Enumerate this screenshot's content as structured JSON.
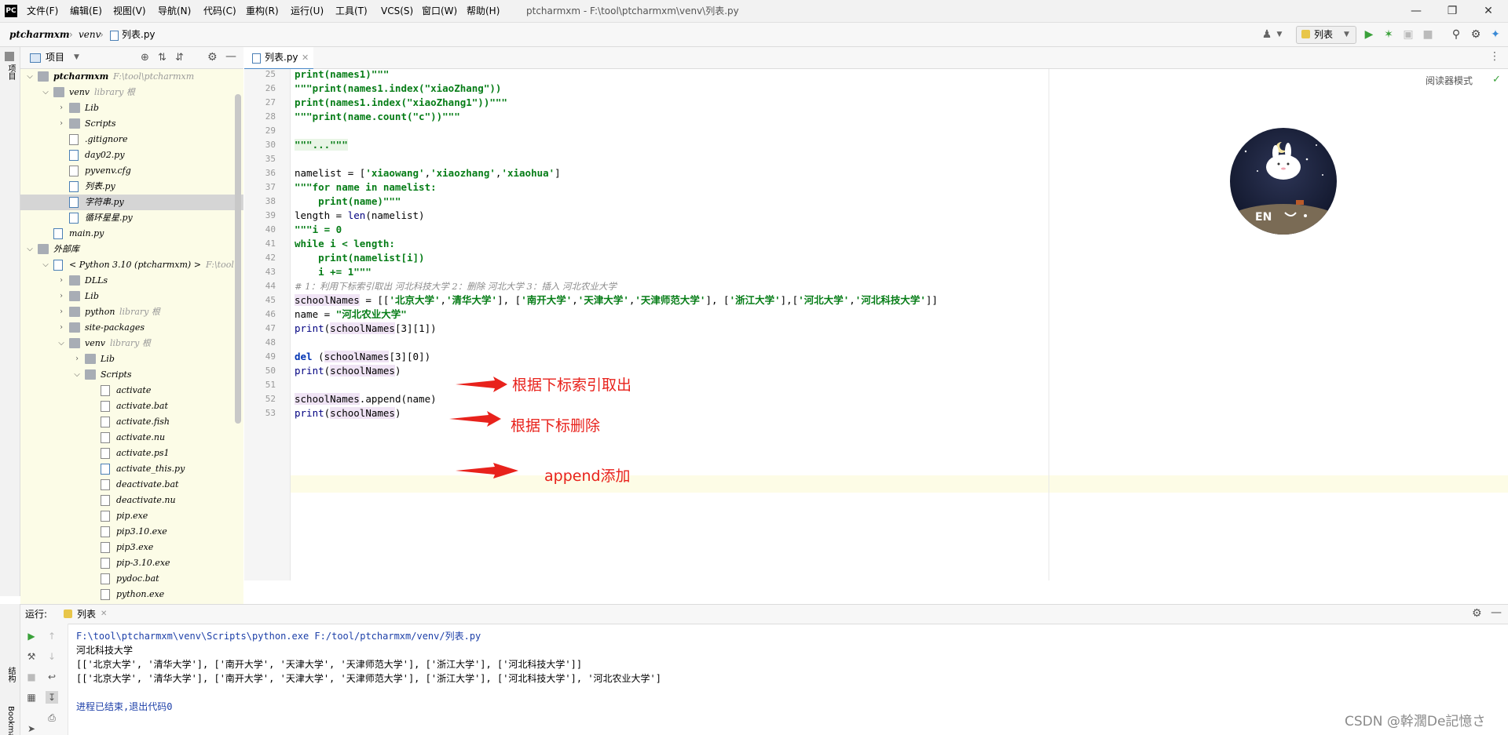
{
  "titlebar": {
    "menu": [
      "文件(F)",
      "编辑(E)",
      "视图(V)",
      "导航(N)",
      "代码(C)",
      "重构(R)",
      "运行(U)",
      "工具(T)",
      "VCS(S)",
      "窗口(W)",
      "帮助(H)"
    ],
    "title": "ptcharmxm - F:\\tool\\ptcharmxm\\venv\\列表.py",
    "logo": "PC"
  },
  "breadcrumb": [
    "ptcharmxm",
    "venv",
    "列表.py"
  ],
  "toolbar": {
    "run_config": "列表"
  },
  "left_strip": {
    "project_label": "项目",
    "structure_label": "结构",
    "bookmarks_label": "Bookmarks"
  },
  "project_panel": {
    "header": "项目",
    "tree": [
      {
        "label": "ptcharmxm",
        "hint": "F:\\tool\\ptcharmxm",
        "level": 0,
        "type": "folder",
        "expanded": true
      },
      {
        "label": "venv",
        "hint": "library 根",
        "level": 1,
        "type": "folder",
        "expanded": true
      },
      {
        "label": "Lib",
        "level": 2,
        "type": "folder",
        "expanded": false
      },
      {
        "label": "Scripts",
        "level": 2,
        "type": "folder",
        "expanded": false
      },
      {
        "label": ".gitignore",
        "level": 2,
        "type": "file"
      },
      {
        "label": "day02.py",
        "level": 2,
        "type": "py"
      },
      {
        "label": "pyvenv.cfg",
        "level": 2,
        "type": "file"
      },
      {
        "label": "列表.py",
        "level": 2,
        "type": "py"
      },
      {
        "label": "字符串.py",
        "level": 2,
        "type": "py",
        "selected": true
      },
      {
        "label": "循环星星.py",
        "level": 2,
        "type": "py"
      },
      {
        "label": "main.py",
        "level": 1,
        "type": "py"
      },
      {
        "label": "外部库",
        "level": 0,
        "type": "lib",
        "expanded": true
      },
      {
        "label": "< Python 3.10 (ptcharmxm) >",
        "hint": "F:\\tool",
        "level": 1,
        "type": "py",
        "expanded": true
      },
      {
        "label": "DLLs",
        "level": 2,
        "type": "folder",
        "expanded": false
      },
      {
        "label": "Lib",
        "level": 2,
        "type": "folder",
        "expanded": false
      },
      {
        "label": "python",
        "hint": "library 根",
        "level": 2,
        "type": "folder",
        "expanded": false
      },
      {
        "label": "site-packages",
        "level": 2,
        "type": "folder",
        "expanded": false
      },
      {
        "label": "venv",
        "hint": "library 根",
        "level": 2,
        "type": "folder",
        "expanded": true
      },
      {
        "label": "Lib",
        "level": 3,
        "type": "folder",
        "expanded": false
      },
      {
        "label": "Scripts",
        "level": 3,
        "type": "folder",
        "expanded": true
      },
      {
        "label": "activate",
        "level": 4,
        "type": "file"
      },
      {
        "label": "activate.bat",
        "level": 4,
        "type": "file"
      },
      {
        "label": "activate.fish",
        "level": 4,
        "type": "file"
      },
      {
        "label": "activate.nu",
        "level": 4,
        "type": "file"
      },
      {
        "label": "activate.ps1",
        "level": 4,
        "type": "file"
      },
      {
        "label": "activate_this.py",
        "level": 4,
        "type": "py"
      },
      {
        "label": "deactivate.bat",
        "level": 4,
        "type": "file"
      },
      {
        "label": "deactivate.nu",
        "level": 4,
        "type": "file"
      },
      {
        "label": "pip.exe",
        "level": 4,
        "type": "file"
      },
      {
        "label": "pip3.10.exe",
        "level": 4,
        "type": "file"
      },
      {
        "label": "pip3.exe",
        "level": 4,
        "type": "file"
      },
      {
        "label": "pip-3.10.exe",
        "level": 4,
        "type": "file"
      },
      {
        "label": "pydoc.bat",
        "level": 4,
        "type": "file"
      },
      {
        "label": "python.exe",
        "level": 4,
        "type": "file"
      }
    ]
  },
  "editor": {
    "tab": "列表.py",
    "reader_mode": "阅读器模式",
    "lines": [
      {
        "n": "25",
        "t": "print(names1)\"\"\""
      },
      {
        "n": "26",
        "t": "\"\"\"print(names1.index(\"xiaoZhang\"))"
      },
      {
        "n": "27",
        "t": "print(names1.index(\"xiaoZhang1\"))\"\"\""
      },
      {
        "n": "28",
        "t": "\"\"\"print(name.count(\"c\"))\"\"\""
      },
      {
        "n": "29",
        "t": ""
      },
      {
        "n": "30",
        "t": "\"\"\"...\"\"\""
      },
      {
        "n": "35",
        "t": ""
      },
      {
        "n": "36",
        "t": "namelist = ['xiaowang','xiaozhang','xiaohua']"
      },
      {
        "n": "37",
        "t": "\"\"\"for name in namelist:"
      },
      {
        "n": "38",
        "t": "    print(name)\"\"\""
      },
      {
        "n": "39",
        "t": "length = len(namelist)"
      },
      {
        "n": "40",
        "t": "\"\"\"i = 0"
      },
      {
        "n": "41",
        "t": "while i < length:"
      },
      {
        "n": "42",
        "t": "    print(namelist[i])"
      },
      {
        "n": "43",
        "t": "    i += 1\"\"\""
      },
      {
        "n": "44",
        "t": "# 1：利用下标索引取出 河北科技大学 2：删除 河北大学 3：插入 河北农业大学"
      },
      {
        "n": "45",
        "t": "schoolNames = [['北京大学','清华大学'], ['南开大学','天津大学','天津师范大学'], ['浙江大学'],['河北大学','河北科技大学']]"
      },
      {
        "n": "46",
        "t": "name = \"河北农业大学\""
      },
      {
        "n": "47",
        "t": "print(schoolNames[3][1])"
      },
      {
        "n": "48",
        "t": ""
      },
      {
        "n": "49",
        "t": "del (schoolNames[3][0])"
      },
      {
        "n": "50",
        "t": "print(schoolNames)"
      },
      {
        "n": "51",
        "t": ""
      },
      {
        "n": "52",
        "t": "schoolNames.append(name)"
      },
      {
        "n": "53",
        "t": "print(schoolNames)"
      }
    ]
  },
  "annotations": [
    "根据下标索引取出",
    "根据下标删除",
    "append添加"
  ],
  "run_panel": {
    "label": "运行:",
    "tab": "列表",
    "output": [
      "F:\\tool\\ptcharmxm\\venv\\Scripts\\python.exe F:/tool/ptcharmxm/venv/列表.py",
      "河北科技大学",
      "[['北京大学', '清华大学'], ['南开大学', '天津大学', '天津师范大学'], ['浙江大学'], ['河北科技大学']]",
      "[['北京大学', '清华大学'], ['南开大学', '天津大学', '天津师范大学'], ['浙江大学'], ['河北科技大学'], '河北农业大学']",
      "",
      "进程已结束,退出代码0"
    ]
  },
  "watermark": "CSDN @幹濶De記憶さ",
  "avatar_text": "EN",
  "colors": {
    "string": "#067d17",
    "keyword": "#0033b3",
    "annotation": "#e8221c",
    "selection": "#d5d5d5"
  }
}
